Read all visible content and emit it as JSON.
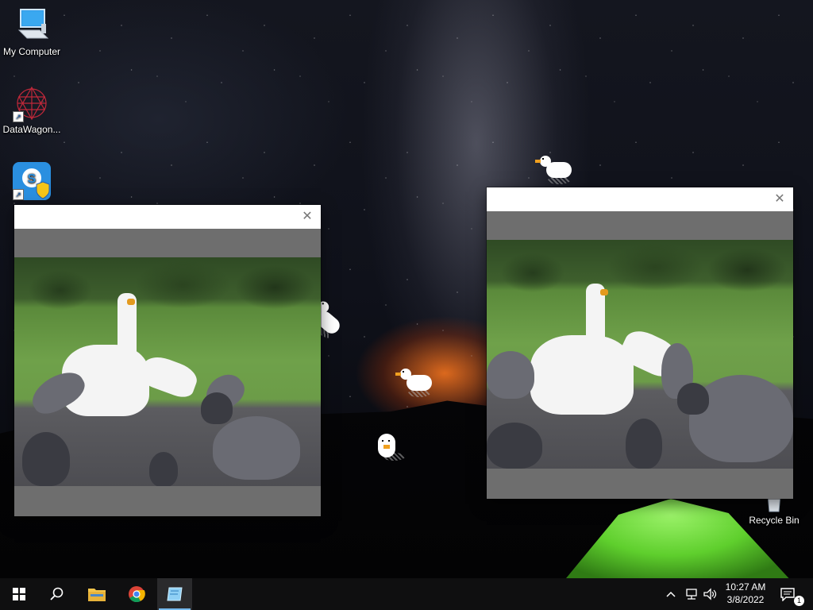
{
  "desktop": {
    "icons": [
      {
        "label": "My Computer",
        "icon": "computer-icon"
      },
      {
        "label": "DataWagon...",
        "icon": "datawagon-icon"
      },
      {
        "label": "",
        "icon": "shield-app-icon"
      },
      {
        "label": "Recycle Bin",
        "icon": "recycle-bin-icon"
      }
    ]
  },
  "windows": [
    {
      "title": "",
      "close_label": "✕",
      "content": "goose-and-pigeons-video"
    },
    {
      "title": "",
      "close_label": "✕",
      "content": "goose-and-pigeons-video"
    }
  ],
  "taskbar": {
    "start_icon": "windows-start-icon",
    "pinned": [
      {
        "name": "search",
        "icon": "search-icon"
      },
      {
        "name": "file-explorer",
        "icon": "folder-icon"
      },
      {
        "name": "chrome",
        "icon": "chrome-icon"
      },
      {
        "name": "app",
        "icon": "notepad-app-icon"
      }
    ],
    "tray": {
      "chevron": "^",
      "clock_time": "10:27 AM",
      "clock_date": "3/8/2022",
      "notifications_count": "1"
    }
  },
  "colors": {
    "taskbar": "#0f0f10",
    "window_frame": "#6e6e6e",
    "accent": "#76b9ed",
    "goose_beak": "#f0a020"
  }
}
